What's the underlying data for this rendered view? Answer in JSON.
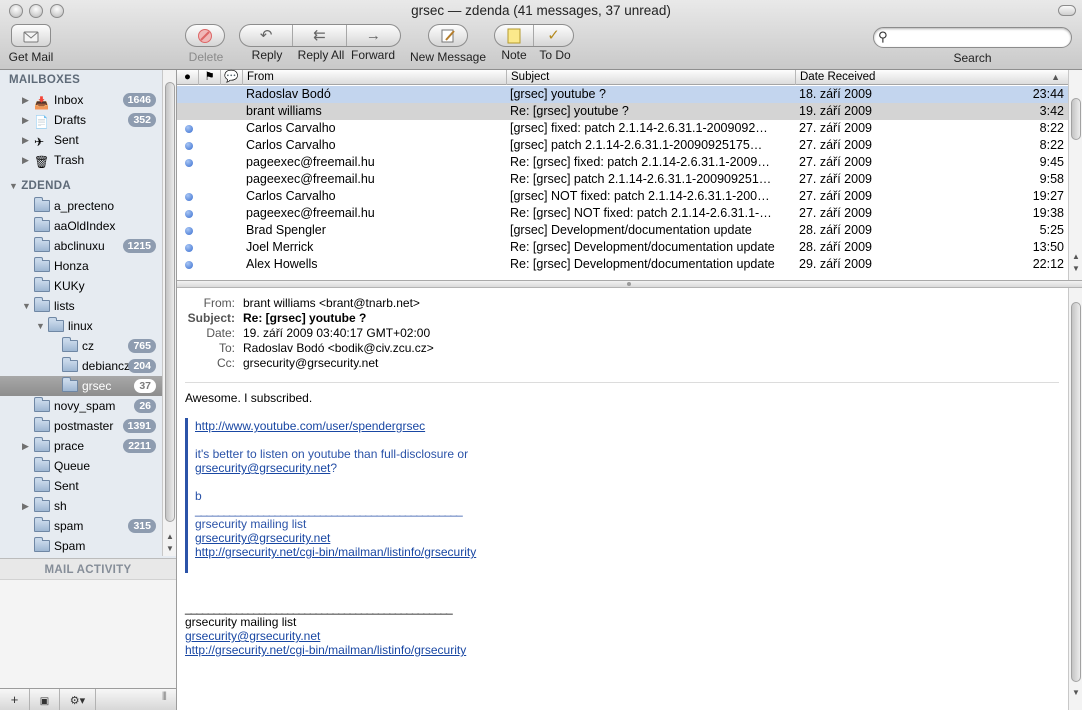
{
  "window": {
    "title": "grsec — zdenda (41 messages, 37 unread)"
  },
  "toolbar": {
    "get_mail": "Get Mail",
    "delete": "Delete",
    "reply": "Reply",
    "reply_all": "Reply All",
    "forward": "Forward",
    "new_message": "New Message",
    "note": "Note",
    "todo": "To Do",
    "search_label": "Search",
    "search_value": ""
  },
  "sidebar": {
    "mailboxes_title": "MAILBOXES",
    "mailboxes": [
      {
        "label": "Inbox",
        "badge": "1646"
      },
      {
        "label": "Drafts",
        "badge": "352"
      },
      {
        "label": "Sent",
        "badge": ""
      },
      {
        "label": "Trash",
        "badge": ""
      }
    ],
    "account_title": "ZDENDA",
    "folders": [
      {
        "label": "a_precteno",
        "badge": ""
      },
      {
        "label": "aaOldIndex",
        "badge": ""
      },
      {
        "label": "abclinuxu",
        "badge": "1215"
      },
      {
        "label": "Honza",
        "badge": ""
      },
      {
        "label": "KUKy",
        "badge": ""
      },
      {
        "label": "lists",
        "badge": ""
      },
      {
        "label": "linux",
        "badge": ""
      },
      {
        "label": "cz",
        "badge": "765"
      },
      {
        "label": "debiancz",
        "badge": "204"
      },
      {
        "label": "grsec",
        "badge": "37"
      },
      {
        "label": "novy_spam",
        "badge": "26"
      },
      {
        "label": "postmaster",
        "badge": "1391"
      },
      {
        "label": "prace",
        "badge": "2211"
      },
      {
        "label": "Queue",
        "badge": ""
      },
      {
        "label": "Sent",
        "badge": ""
      },
      {
        "label": "sh",
        "badge": ""
      },
      {
        "label": "spam",
        "badge": "315"
      },
      {
        "label": "Spam",
        "badge": ""
      }
    ],
    "activity_title": "MAIL ACTIVITY",
    "add_glyph": "+",
    "gear_glyph": "⚙▾"
  },
  "message_list": {
    "columns": {
      "from": "From",
      "subject": "Subject",
      "date": "Date Received"
    },
    "rows": [
      {
        "unread": false,
        "from": "Radoslav Bodó",
        "subject": "[grsec] youtube ?",
        "date": "18. září 2009",
        "time": "23:44"
      },
      {
        "unread": false,
        "from": "brant williams",
        "subject": "Re: [grsec] youtube ?",
        "date": "19. září 2009",
        "time": "3:42"
      },
      {
        "unread": true,
        "from": "Carlos Carvalho",
        "subject": "[grsec] fixed: patch 2.1.14-2.6.31.1-2009092…",
        "date": "27. září 2009",
        "time": "8:22"
      },
      {
        "unread": true,
        "from": "Carlos Carvalho",
        "subject": "[grsec] patch 2.1.14-2.6.31.1-20090925175…",
        "date": "27. září 2009",
        "time": "8:22"
      },
      {
        "unread": true,
        "from": "pageexec@freemail.hu",
        "subject": "Re: [grsec] fixed: patch 2.1.14-2.6.31.1-2009…",
        "date": "27. září 2009",
        "time": "9:45"
      },
      {
        "unread": false,
        "from": "pageexec@freemail.hu",
        "subject": "Re: [grsec] patch 2.1.14-2.6.31.1-200909251…",
        "date": "27. září 2009",
        "time": "9:58"
      },
      {
        "unread": true,
        "from": "Carlos Carvalho",
        "subject": "[grsec] NOT fixed: patch 2.1.14-2.6.31.1-200…",
        "date": "27. září 2009",
        "time": "19:27"
      },
      {
        "unread": true,
        "from": "pageexec@freemail.hu",
        "subject": "Re: [grsec] NOT fixed: patch 2.1.14-2.6.31.1-…",
        "date": "27. září 2009",
        "time": "19:38"
      },
      {
        "unread": true,
        "from": "Brad Spengler",
        "subject": "[grsec] Development/documentation update",
        "date": "28. září 2009",
        "time": "5:25"
      },
      {
        "unread": true,
        "from": "Joel Merrick",
        "subject": "Re: [grsec] Development/documentation update",
        "date": "28. září 2009",
        "time": "13:50"
      },
      {
        "unread": true,
        "from": "Alex Howells",
        "subject": "Re: [grsec] Development/documentation update",
        "date": "29. září 2009",
        "time": "22:12"
      }
    ]
  },
  "preview": {
    "from_key": "From:",
    "from": "brant williams <brant@tnarb.net>",
    "subject_key": "Subject:",
    "subject": "Re: [grsec] youtube ?",
    "date_key": "Date:",
    "date": "19. září 2009 03:40:17 GMT+02:00",
    "to_key": "To:",
    "to": "Radoslav Bodó <bodik@civ.zcu.cz>",
    "cc_key": "Cc:",
    "cc": "grsecurity@grsecurity.net",
    "body_line": "Awesome.  I subscribed.",
    "quote_link": "http://www.youtube.com/user/spendergrsec",
    "quote_line1": "it's better to listen on youtube than full-disclosure or",
    "quote_email": "grsecurity@grsecurity.net",
    "quote_q": "?",
    "quote_sig": "b",
    "quote_rule": "_______________________________________________",
    "quote_list": "grsecurity mailing list",
    "quote_list_email": "grsecurity@grsecurity.net",
    "quote_list_url": "http://grsecurity.net/cgi-bin/mailman/listinfo/grsecurity",
    "footer_rule": "_______________________________________________",
    "footer_list": "grsecurity mailing list",
    "footer_email": "grsecurity@grsecurity.net",
    "footer_url": "http://grsecurity.net/cgi-bin/mailman/listinfo/grsecurity"
  }
}
